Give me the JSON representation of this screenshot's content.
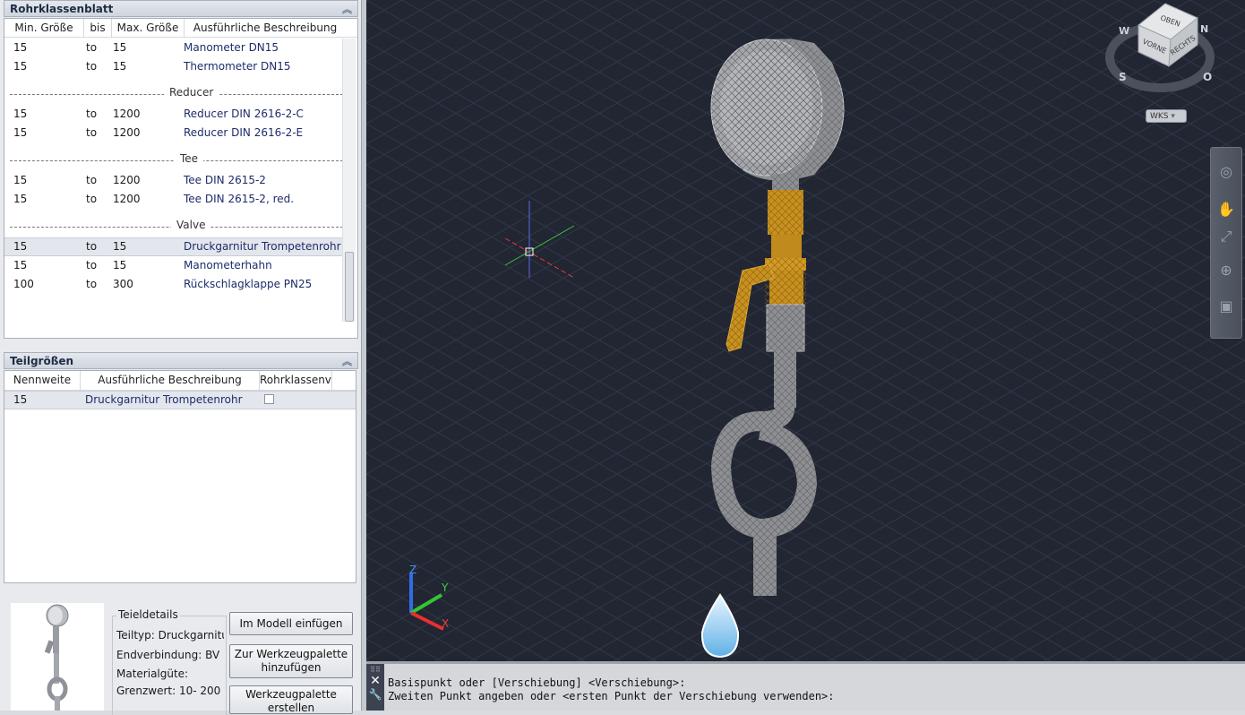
{
  "panel1": {
    "title": "Rohrklassenblatt",
    "columns": [
      "Min. Größe",
      "bis",
      "Max. Größe",
      "Ausführliche Beschreibung"
    ],
    "rows": [
      {
        "min": "15",
        "bis": "to",
        "max": "15",
        "desc": "Manometer DN15"
      },
      {
        "min": "15",
        "bis": "to",
        "max": "15",
        "desc": "Thermometer DN15"
      },
      {
        "min": "15",
        "bis": "to",
        "max": "1200",
        "desc": "Reducer DIN 2616-2-C"
      },
      {
        "min": "15",
        "bis": "to",
        "max": "1200",
        "desc": "Reducer DIN 2616-2-E"
      },
      {
        "min": "15",
        "bis": "to",
        "max": "1200",
        "desc": "Tee DIN 2615-2"
      },
      {
        "min": "15",
        "bis": "to",
        "max": "1200",
        "desc": "Tee DIN 2615-2, red."
      },
      {
        "min": "15",
        "bis": "to",
        "max": "15",
        "desc": "Druckgarnitur Trompetenrohr"
      },
      {
        "min": "15",
        "bis": "to",
        "max": "15",
        "desc": "Manometerhahn"
      },
      {
        "min": "100",
        "bis": "to",
        "max": "300",
        "desc": "Rückschlagklappe PN25"
      }
    ],
    "groups": [
      "Reducer",
      "Tee",
      "Valve"
    ]
  },
  "panel2": {
    "title": "Teilgrößen",
    "columns": [
      "Nennweite",
      "Ausführliche Beschreibung",
      "Rohrklassenvo"
    ],
    "rows": [
      {
        "nennweite": "15",
        "desc": "Druckgarnitur Trompetenrohr"
      }
    ]
  },
  "details": {
    "title": "Teieldetails",
    "teiltyp": "Teiltyp: Druckgarnitur",
    "endverbindung": "Endverbindung: BV",
    "material": "Materialgüte:",
    "grenzwert": "Grenzwert: 10- 200",
    "btn_insert": "Im Modell einfügen",
    "btn_palette_l1": "Zur Werkzeugpalette",
    "btn_palette_l2": "hinzufügen",
    "btn_create_l1": "Werkzeugpalette",
    "btn_create_l2": "erstellen"
  },
  "viewcube": {
    "top": "OBEN",
    "front": "VORNE",
    "right": "RECHTS",
    "n": "N",
    "w": "W",
    "s": "S",
    "o": "O",
    "wks": "WKS"
  },
  "axes": {
    "x": "X",
    "y": "Y",
    "z": "Z"
  },
  "command": {
    "line1": "Basispunkt oder [Verschiebung] <Verschiebung>:",
    "line2": "Zweiten Punkt angeben oder <ersten Punkt der Verschiebung verwenden>:"
  },
  "colors": {
    "viewport_bg": "#212632",
    "pipe_gray": "#8e8f92",
    "valve_gold": "#c8901e",
    "cursor_red": "#e03a3a",
    "cursor_green": "#3ec23e",
    "cursor_blue": "#5a6ae8"
  }
}
